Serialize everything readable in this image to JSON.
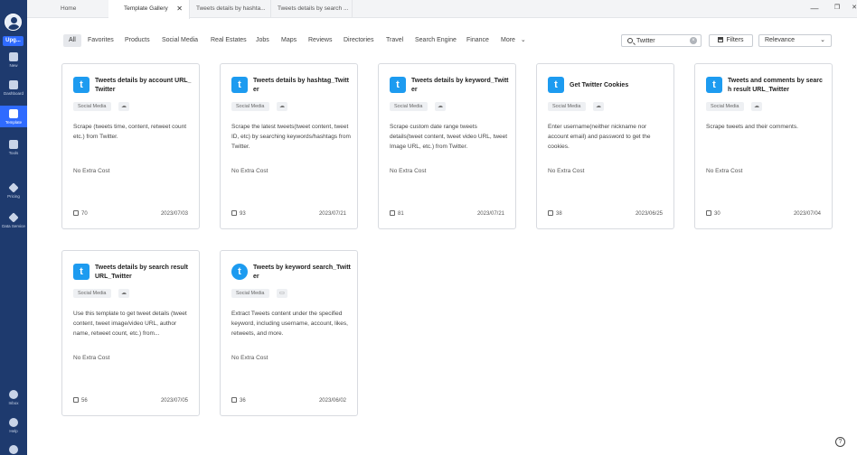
{
  "sidebar": {
    "upgrade_label": "Upg...",
    "items": [
      {
        "label": "New"
      },
      {
        "label": "Dashboard"
      },
      {
        "label": "Template"
      },
      {
        "label": "Tools"
      },
      {
        "label": "Pricing"
      },
      {
        "label": "Data Service"
      },
      {
        "label": "Inbox"
      },
      {
        "label": "Help"
      }
    ]
  },
  "tabs": [
    {
      "label": "Home"
    },
    {
      "label": "Template Gallery"
    },
    {
      "label": "Tweets details by hashta..."
    },
    {
      "label": "Tweets details by search ..."
    }
  ],
  "window": {
    "minimize": "—",
    "maximize": "❐",
    "close": "✕"
  },
  "categories": [
    "All",
    "Favorites",
    "Products",
    "Social Media",
    "Real Estates",
    "Jobs",
    "Maps",
    "Reviews",
    "Directories",
    "Travel",
    "Search Engine",
    "Finance",
    "More"
  ],
  "search": {
    "value": "Twitter"
  },
  "filters_label": "Filters",
  "sort_label": "Relevance",
  "cards": [
    {
      "title": "Tweets details by account URL_Twitter",
      "tag": "Social Media",
      "desc": "Scrape (tweets time, content, retweet count etc.) from Twitter.",
      "cost": "No Extra Cost",
      "likes": "70",
      "date": "2023/07/03"
    },
    {
      "title": "Tweets details by hashtag_Twitter",
      "tag": "Social Media",
      "desc": "Scrape the latest tweets(tweet content, tweet ID, etc) by searching keywords/hashtags from Twitter.",
      "cost": "No Extra Cost",
      "likes": "93",
      "date": "2023/07/21"
    },
    {
      "title": "Tweets details by keyword_Twitter",
      "tag": "Social Media",
      "desc": "Scrape custom date range tweets details(tweet content, tweet video URL, tweet Image URL, etc.) from Twitter.",
      "cost": "No Extra Cost",
      "likes": "81",
      "date": "2023/07/21"
    },
    {
      "title": "Get Twitter Cookies",
      "tag": "Social Media",
      "desc": "Enter username(neither nickname nor account email) and password to get the cookies.",
      "cost": "No Extra Cost",
      "likes": "38",
      "date": "2023/06/25"
    },
    {
      "title": "Tweets and comments by search result URL_Twitter",
      "tag": "Social Media",
      "desc": "Scrape tweets and their comments.",
      "cost": "No Extra Cost",
      "likes": "30",
      "date": "2023/07/04"
    },
    {
      "title": "Tweets details by search result URL_Twitter",
      "tag": "Social Media",
      "desc": "Use this template to get tweet details (tweet content, tweet image/video URL, author name, retweet count, etc.) from...",
      "cost": "No Extra Cost",
      "likes": "56",
      "date": "2023/07/05"
    },
    {
      "title": "Tweets by keyword search_Twitter",
      "tag": "Social Media",
      "desc": "Extract Tweets content under the specified keyword, including username, account, likes, retweets, and more.",
      "cost": "No Extra Cost",
      "likes": "36",
      "date": "2023/06/02"
    }
  ],
  "colors": {
    "sidebar": "#1e3a6e",
    "accent": "#2f6bff",
    "twitter": "#1d9bf0"
  }
}
